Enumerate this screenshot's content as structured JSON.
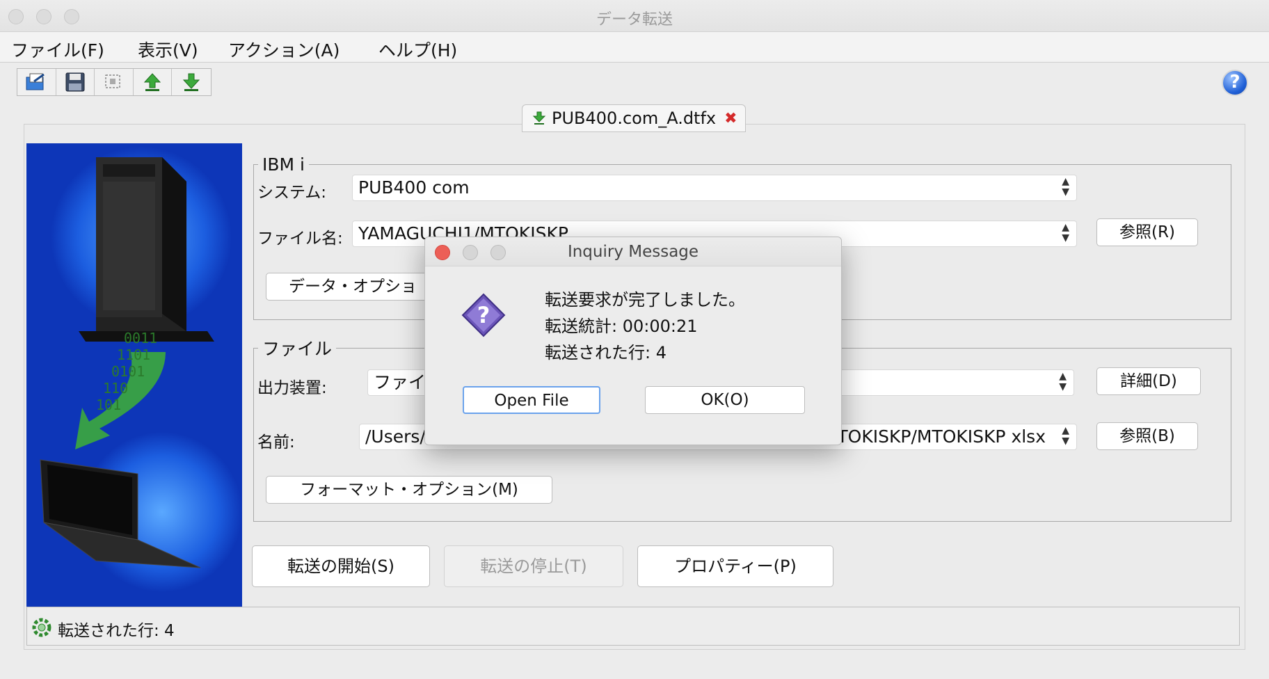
{
  "window": {
    "title": "データ転送"
  },
  "menu": {
    "file": "ファイル(F)",
    "view": "表示(V)",
    "action": "アクション(A)",
    "help": "ヘルプ(H)"
  },
  "toolbar": {
    "icons": [
      "open-file-icon",
      "save-icon",
      "select-icon",
      "upload-icon",
      "download-icon"
    ]
  },
  "tab": {
    "label": "PUB400.com_A.dtfx"
  },
  "ibmi": {
    "legend": "IBM i",
    "system_label": "システム:",
    "system_value": "PUB400 com",
    "file_label": "ファイル名:",
    "file_value": "YAMAGUCHI1/MTOKISKP",
    "browse_r": "参照(R)",
    "data_options": "データ・オプショ"
  },
  "file": {
    "legend": "ファイル",
    "output_label": "出力装置:",
    "output_value": "ファイ",
    "details": "詳細(D)",
    "name_label": "名前:",
    "name_value_left": "/Users/",
    "name_value_right": "TOKISKP/MTOKISKP xlsx",
    "browse_b": "参照(B)",
    "format_options": "フォーマット・オプション(M)"
  },
  "actions": {
    "start": "転送の開始(S)",
    "stop": "転送の停止(T)",
    "properties": "プロパティー(P)"
  },
  "status": {
    "text": "転送された行: 4"
  },
  "dialog": {
    "title": "Inquiry Message",
    "line1": "転送要求が完了しました。",
    "line2": "転送統計: 00:00:21",
    "line3": "転送された行: 4",
    "open_file": "Open File",
    "ok": "OK(O)"
  },
  "side_image": {
    "binary_lines": [
      "0011",
      "1101",
      "0101",
      "110",
      "101"
    ]
  },
  "colors": {
    "side_blue": "#0d36b8",
    "close_red": "#ec5f57",
    "default_button_border": "#6aa2ec",
    "question_purple": "#6a54b8"
  }
}
